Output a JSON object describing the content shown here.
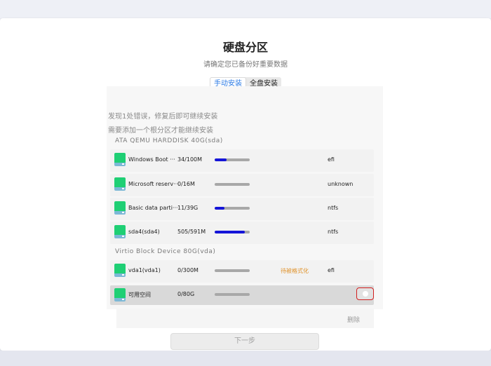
{
  "header": {
    "title": "硬盘分区",
    "subtitle": "请确定您已备份好重要数据"
  },
  "tabs": [
    {
      "label": "手动安装",
      "active": true
    },
    {
      "label": "全盘安装",
      "active": false
    }
  ],
  "errors": [
    "发现1处错误，修复后即可继续安装",
    "需要添加一个根分区才能继续安装"
  ],
  "disks": [
    {
      "label": "ATA  QEMU  HARDDISK  40G(sda)",
      "partitions": [
        {
          "name": "Windows Boot ···",
          "size": "34/100M",
          "usage": 0.34,
          "status": "",
          "fs": "efi"
        },
        {
          "name": "Microsoft reserv···",
          "size": "0/16M",
          "usage": 0,
          "status": "",
          "fs": "unknown"
        },
        {
          "name": "Basic data parti···",
          "size": "11/39G",
          "usage": 0.28,
          "status": "",
          "fs": "ntfs"
        },
        {
          "name": "sda4(sda4)",
          "size": "505/591M",
          "usage": 0.85,
          "status": "",
          "fs": "ntfs"
        }
      ]
    },
    {
      "label": "Virtio  Block  Device  80G(vda)",
      "partitions": [
        {
          "name": "vda1(vda1)",
          "size": "0/300M",
          "usage": 0,
          "status": "待被格式化",
          "fs": "efi"
        },
        {
          "name": "可用空间",
          "size": "0/80G",
          "usage": 0,
          "status": "",
          "fs": "",
          "selected": true
        }
      ]
    }
  ],
  "actions": {
    "delete_label": "删除",
    "next_label": "下一步"
  },
  "colors": {
    "accent": "#2c7be5",
    "usage_bar": "#1414d8",
    "pending_status": "#e0922a",
    "disk_icon": "#1fcf74",
    "highlight_border": "#d21f1f"
  }
}
